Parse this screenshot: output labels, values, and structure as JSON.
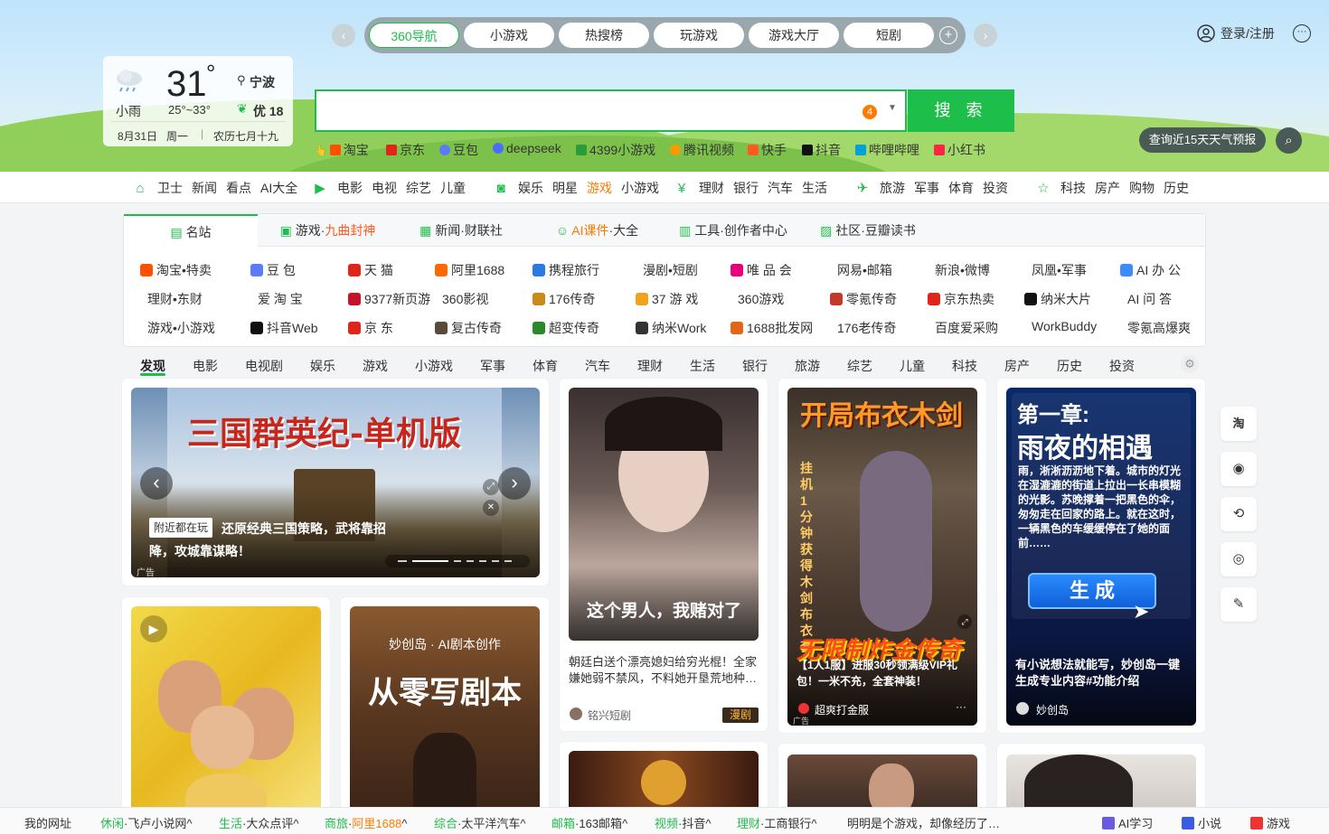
{
  "header": {
    "tabs": [
      "360导航",
      "小游戏",
      "热搜榜",
      "玩游戏",
      "游戏大厅",
      "短剧"
    ],
    "login_label": "登录/注册",
    "search_button": "搜 索",
    "search_badge": "4",
    "weather_forecast_button": "查询近15天天气预报"
  },
  "weather": {
    "condition": "小雨",
    "temp": "31",
    "degree": "°",
    "range": "25°~33°",
    "city": "宁波",
    "air": "优 18",
    "date": "8月31日",
    "weekday": "周一",
    "lunar": "农历七月十九"
  },
  "quick_links": [
    {
      "label": "淘宝",
      "color": "#ff5000"
    },
    {
      "label": "京东",
      "color": "#e1251b"
    },
    {
      "label": "豆包",
      "color": "#5b7cf6"
    },
    {
      "label": "deepseek",
      "color": "#4d6bfe"
    },
    {
      "label": "4399小游戏",
      "color": "#2a9d3a"
    },
    {
      "label": "腾讯视频",
      "color": "#ff9900"
    },
    {
      "label": "快手",
      "color": "#ff5a1f"
    },
    {
      "label": "抖音",
      "color": "#111111"
    },
    {
      "label": "哔哩哔哩",
      "color": "#00a1d6"
    },
    {
      "label": "小红书",
      "color": "#ff2442"
    }
  ],
  "nav_groups": [
    {
      "icon": "home-icon",
      "items": [
        "卫士",
        "新闻",
        "看点",
        "AI大全"
      ]
    },
    {
      "icon": "play-icon",
      "items": [
        "电影",
        "电视",
        "综艺",
        "儿童"
      ]
    },
    {
      "icon": "camera-icon",
      "items": [
        "娱乐",
        "明星",
        "游戏",
        "小游戏"
      ]
    },
    {
      "icon": "yuan-icon",
      "items": [
        "理财",
        "银行",
        "汽车",
        "生活"
      ]
    },
    {
      "icon": "travel-icon",
      "items": [
        "旅游",
        "军事",
        "体育",
        "投资"
      ]
    },
    {
      "icon": "star-icon",
      "items": [
        "科技",
        "房产",
        "购物",
        "历史"
      ]
    }
  ],
  "panel_tabs": [
    {
      "pre": "名站",
      "hl": "",
      "post": ""
    },
    {
      "pre": "游戏·",
      "hl": "九曲封神",
      "post": ""
    },
    {
      "pre": "新闻·财联社",
      "hl": "",
      "post": ""
    },
    {
      "pre": "",
      "hl": "AI课件",
      "post": "·大全"
    },
    {
      "pre": "工具·创作者中心",
      "hl": "",
      "post": ""
    },
    {
      "pre": "社区·豆瓣读书",
      "hl": "",
      "post": ""
    }
  ],
  "sites": [
    [
      "淘宝•特卖",
      "豆 包",
      "天 猫",
      "阿里1688",
      "携程旅行",
      "漫剧•短剧",
      "唯 品 会",
      "网易•邮箱",
      "新浪•微博",
      "凤凰•军事",
      "AI 办 公"
    ],
    [
      "理财•东财",
      "爱 淘 宝",
      "9377新页游",
      "360影视",
      "176传奇",
      "37 游 戏",
      "360游戏",
      "零氪传奇",
      "京东热卖",
      "纳米大片",
      "AI 问 答"
    ],
    [
      "游戏•小游戏",
      "抖音Web",
      "京 东",
      "复古传奇",
      "超变传奇",
      "纳米Work",
      "1688批发网",
      "176老传奇",
      "百度爱采购",
      "WorkBuddy",
      "零氪高爆爽"
    ]
  ],
  "categories": [
    "发现",
    "电影",
    "电视剧",
    "娱乐",
    "游戏",
    "小游戏",
    "军事",
    "体育",
    "汽车",
    "理财",
    "生活",
    "银行",
    "旅游",
    "综艺",
    "儿童",
    "科技",
    "房产",
    "历史",
    "投资"
  ],
  "cards": {
    "banner": {
      "title_image": "三国群英纪-单机版",
      "tag": "附近都在玩",
      "caption": "还原经典三国策略，武将靠招降，攻城靠谋略！",
      "ad": "广告"
    },
    "card2": {
      "overlay": "这个男人，我赌对了",
      "title": "朝廷白送个漂亮媳妇给穷光棍！全家嫌她弱不禁风，不料她开垦荒地种…",
      "author": "铭兴短剧",
      "badge": "漫剧"
    },
    "card3": {
      "title_image": "开局布衣木剑",
      "side_text": "挂机1分钟 获得木剑布衣套",
      "overlay": "无限制炸金传奇",
      "caption": "【1人1服】进服30秒领满级VIP礼包！一米不充，全套神装！",
      "author": "超爽打金服",
      "ad": "广告"
    },
    "card4": {
      "heading1": "第一章:",
      "heading2": "雨夜的相遇",
      "body": "雨，淅淅沥沥地下着。城市的灯光在湿漉漉的街道上拉出一长串模糊的光影。苏晚撑着一把黑色的伞，匆匆走在回家的路上。就在这时，一辆黑色的车缓缓停在了她的面前……",
      "button": "生 成",
      "caption": "有小说想法就能写，妙创岛一键生成专业内容#功能介绍",
      "author": "妙创岛"
    },
    "card6": {
      "top": "妙创岛 · AI剧本创作",
      "big": "从零写剧本"
    }
  },
  "side_buttons": [
    "淘",
    "bag-icon",
    "game-icon",
    "video-icon",
    "feather-icon"
  ],
  "bottom": {
    "my_sites": "我的网址",
    "links": [
      {
        "k": "休闲",
        "v": "飞卢小说网",
        "c": "g"
      },
      {
        "k": "生活",
        "v": "大众点评",
        "c": "g"
      },
      {
        "k": "商旅",
        "v": "阿里1688",
        "c": "o"
      },
      {
        "k": "综合",
        "v": "太平洋汽车",
        "c": "g"
      },
      {
        "k": "邮箱",
        "v": "163邮箱",
        "c": "g"
      },
      {
        "k": "视频",
        "v": "抖音",
        "c": "g"
      },
      {
        "k": "理财",
        "v": "工商银行",
        "c": "g"
      }
    ],
    "news": "明明是个游戏，却像经历了…",
    "ai_study": "AI学习",
    "novel": "小说",
    "game": "游戏"
  }
}
